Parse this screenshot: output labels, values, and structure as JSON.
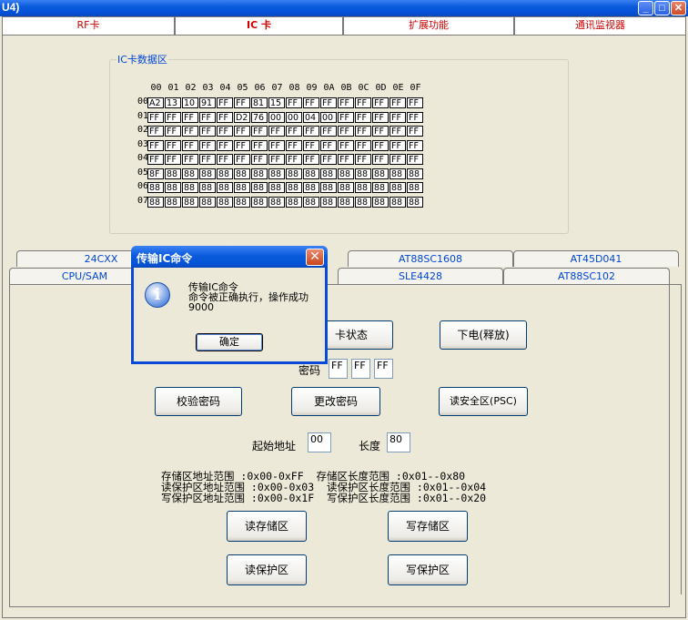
{
  "window": {
    "title": "U4)"
  },
  "top_tabs": [
    "RF卡",
    "IC 卡",
    "扩展功能",
    "通讯监视器"
  ],
  "group_title": "IC卡数据区",
  "grid": {
    "col_headers": [
      "00",
      "01",
      "02",
      "03",
      "04",
      "05",
      "06",
      "07",
      "08",
      "09",
      "0A",
      "0B",
      "0C",
      "0D",
      "0E",
      "0F"
    ],
    "row_headers": [
      "00",
      "01",
      "02",
      "03",
      "04",
      "05",
      "06",
      "07"
    ],
    "rows": [
      [
        "A2",
        "13",
        "10",
        "91",
        "FF",
        "FF",
        "81",
        "15",
        "FF",
        "FF",
        "FF",
        "FF",
        "FF",
        "FF",
        "FF",
        "FF"
      ],
      [
        "FF",
        "FF",
        "FF",
        "FF",
        "FF",
        "D2",
        "76",
        "00",
        "00",
        "04",
        "00",
        "FF",
        "FF",
        "FF",
        "FF",
        "FF"
      ],
      [
        "FF",
        "FF",
        "FF",
        "FF",
        "FF",
        "FF",
        "FF",
        "FF",
        "FF",
        "FF",
        "FF",
        "FF",
        "FF",
        "FF",
        "FF",
        "FF"
      ],
      [
        "FF",
        "FF",
        "FF",
        "FF",
        "FF",
        "FF",
        "FF",
        "FF",
        "FF",
        "FF",
        "FF",
        "FF",
        "FF",
        "FF",
        "FF",
        "FF"
      ],
      [
        "FF",
        "FF",
        "FF",
        "FF",
        "FF",
        "FF",
        "FF",
        "FF",
        "FF",
        "FF",
        "FF",
        "FF",
        "FF",
        "FF",
        "FF",
        "FF"
      ],
      [
        "8F",
        "88",
        "88",
        "88",
        "88",
        "88",
        "88",
        "88",
        "88",
        "88",
        "88",
        "88",
        "88",
        "88",
        "88",
        "88"
      ],
      [
        "88",
        "88",
        "88",
        "88",
        "88",
        "88",
        "88",
        "88",
        "88",
        "88",
        "88",
        "88",
        "88",
        "88",
        "88",
        "88"
      ],
      [
        "88",
        "88",
        "88",
        "88",
        "88",
        "88",
        "88",
        "88",
        "88",
        "88",
        "88",
        "88",
        "88",
        "88",
        "88",
        "88"
      ]
    ]
  },
  "sub_tabs_row1": [
    "24CXX",
    "AT88SC1608",
    "AT45D041"
  ],
  "sub_tabs_row2": [
    "CPU/SAM",
    "SLE4428",
    "AT88SC102"
  ],
  "buttons": {
    "card_status": "卡状态",
    "power_off": "下电(释放)",
    "verify_pwd": "校验密码",
    "change_pwd": "更改密码",
    "read_secure": "读安全区(PSC)",
    "read_storage": "读存储区",
    "write_storage": "写存储区",
    "read_protect": "读保护区",
    "write_protect": "写保护区"
  },
  "password": {
    "label": "密码",
    "values": [
      "FF",
      "FF",
      "FF"
    ]
  },
  "start_addr": {
    "label": "起始地址",
    "value": "00"
  },
  "length": {
    "label": "长度",
    "value": "80"
  },
  "info_lines": [
    "存储区地址范围 :0x00-0xFF  存储区长度范围 :0x01--0x80",
    "读保护区地址范围 :0x00-0x03  读保护区长度范围 :0x01--0x04",
    "写保护区地址范围 :0x00-0x1F  写保护区长度范围 :0x01--0x20"
  ],
  "dialog": {
    "title": "传输IC命令",
    "line1": "传输IC命令",
    "line2": "命令被正确执行，操作成功",
    "line3": "9000",
    "ok": "确定"
  }
}
